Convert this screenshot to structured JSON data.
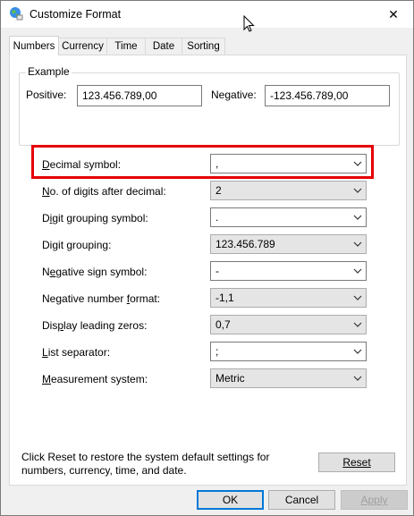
{
  "window": {
    "title": "Customize Format",
    "close_glyph": "✕"
  },
  "tabs": [
    "Numbers",
    "Currency",
    "Time",
    "Date",
    "Sorting"
  ],
  "active_tab": "Numbers",
  "example": {
    "group_label": "Example",
    "positive_label": "Positive:",
    "positive_value": "123.456.789,00",
    "negative_label": "Negative:",
    "negative_value": "-123.456.789,00"
  },
  "settings": [
    {
      "key": "D",
      "label_rest": "ecimal symbol:",
      "value": ",",
      "kind": "edit"
    },
    {
      "key": "N",
      "label_rest": "o. of digits after decimal:",
      "value": "2",
      "kind": "ro"
    },
    {
      "pre": "D",
      "key": "i",
      "label_rest": "git grouping symbol:",
      "value": ".",
      "kind": "edit"
    },
    {
      "pre": "Di",
      "key": "g",
      "label_rest": "it grouping:",
      "value": "123.456.789",
      "kind": "ro"
    },
    {
      "pre": "N",
      "key": "e",
      "label_rest": "gative sign symbol:",
      "value": "-",
      "kind": "edit"
    },
    {
      "pre": "Negative number ",
      "key": "f",
      "label_rest": "ormat:",
      "value": "-1,1",
      "kind": "ro"
    },
    {
      "pre": "Dis",
      "key": "p",
      "label_rest": "lay leading zeros:",
      "value": "0,7",
      "kind": "ro"
    },
    {
      "key": "L",
      "label_rest": "ist separator:",
      "value": ";",
      "kind": "edit"
    },
    {
      "key": "M",
      "label_rest": "easurement system:",
      "value": "Metric",
      "kind": "ro"
    }
  ],
  "info_text": "Click Reset to restore the system default settings for numbers, currency, time, and date.",
  "buttons": {
    "reset": "Reset",
    "ok": "OK",
    "cancel": "Cancel",
    "apply": "Apply"
  },
  "colors": {
    "highlight": "#e50000",
    "focus": "#0078d7"
  }
}
